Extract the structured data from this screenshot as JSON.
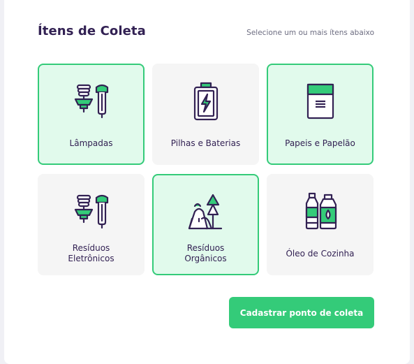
{
  "colors": {
    "primary": "#34CB79",
    "selected_bg": "#E1FAEC",
    "title": "#322153",
    "item_bg": "#F5F5F5"
  },
  "header": {
    "title": "Ítens de Coleta",
    "subtitle": "Selecione um ou mais ítens abaixo"
  },
  "items": [
    {
      "label": "Lâmpadas",
      "icon": "lamps-icon",
      "selected": true
    },
    {
      "label": "Pilhas e Baterias",
      "icon": "battery-icon",
      "selected": false
    },
    {
      "label": "Papeis e Papelão",
      "icon": "paper-icon",
      "selected": true
    },
    {
      "label": "Resíduos\nEletrônicos",
      "icon": "electronics-icon",
      "selected": false
    },
    {
      "label": "Resíduos\nOrgânicos",
      "icon": "organic-icon",
      "selected": true
    },
    {
      "label": "Óleo de Cozinha",
      "icon": "oil-icon",
      "selected": false
    }
  ],
  "actions": {
    "submit_label": "Cadastrar ponto de coleta"
  }
}
